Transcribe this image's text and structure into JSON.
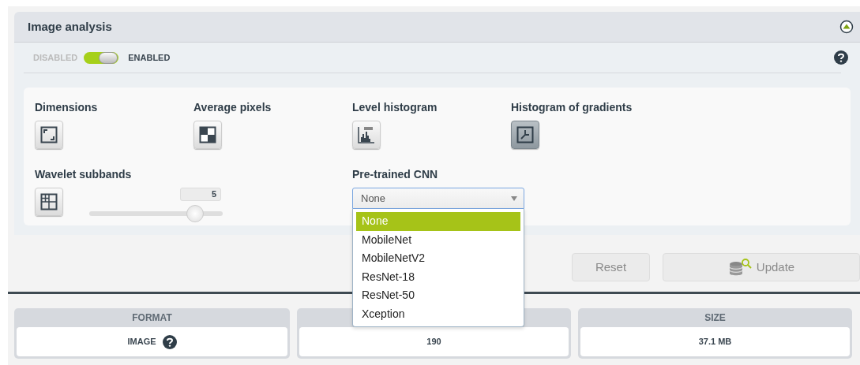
{
  "panel": {
    "title": "Image analysis",
    "expanded": true
  },
  "switch": {
    "off_label": "DISABLED",
    "on_label": "ENABLED",
    "on": true
  },
  "features": [
    {
      "kind": "toggle",
      "label": "Dimensions",
      "selected": false
    },
    {
      "kind": "toggle",
      "label": "Average pixels",
      "selected": false
    },
    {
      "kind": "toggle",
      "label": "Level histogram",
      "selected": false
    },
    {
      "kind": "toggle",
      "label": "Histogram of gradients",
      "selected": true
    },
    {
      "kind": "slider",
      "label": "Wavelet subbands",
      "value": "5",
      "level": 0.79
    },
    {
      "kind": "dropdown",
      "label": "Pre-trained CNN",
      "value": "None",
      "expanded": true,
      "options": [
        {
          "label": "None",
          "selected": true
        },
        {
          "label": "MobileNet",
          "selected": false
        },
        {
          "label": "MobileNetV2",
          "selected": false
        },
        {
          "label": "ResNet-18",
          "selected": false
        },
        {
          "label": "ResNet-50",
          "selected": false
        },
        {
          "label": "Xception",
          "selected": false
        }
      ]
    }
  ],
  "buttons": [
    {
      "label": "Reset",
      "disabled": true
    },
    {
      "label": "Update",
      "disabled": true
    }
  ],
  "stats": [
    {
      "heading": "FORMAT",
      "value": "IMAGE",
      "help": true
    },
    {
      "value": "190",
      "help": false
    },
    {
      "heading": "SIZE",
      "value": "37.1 MB",
      "help": false
    }
  ]
}
